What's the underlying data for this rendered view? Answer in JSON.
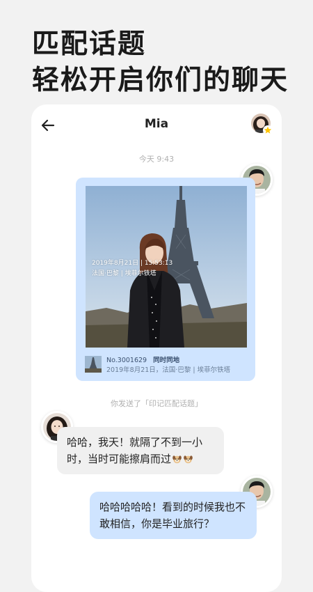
{
  "promo": {
    "line1": "匹配话题",
    "line2": "轻松开启你们的聊天"
  },
  "chat": {
    "title": "Mia",
    "timestamp": "今天 9:43",
    "card": {
      "photo_date": "2019年8月21日 | 15:53:13",
      "photo_place": "法国·巴黎 | 埃菲尔铁塔",
      "number": "No.3001629",
      "number_tag": "同时同地",
      "meta": "2019年8月21日，法国·巴黎 | 埃菲尔铁塔"
    },
    "notice": "你发送了「印记匹配话题」",
    "messages": [
      {
        "from": "Mia",
        "text": "哈哈，我天！就隔了不到一小时，当时可能擦肩而过"
      },
      {
        "from": "me",
        "text": "哈哈哈哈哈！看到的时候我也不敢相信，你是毕业旅行？"
      }
    ]
  },
  "icons": {
    "back": "arrow-left-icon",
    "star": "star-icon",
    "emoji": "dog-face-icon"
  },
  "colors": {
    "sent_bubble": "#cfe4ff",
    "received_bubble": "#f0f0f0",
    "star": "#ffc400"
  }
}
